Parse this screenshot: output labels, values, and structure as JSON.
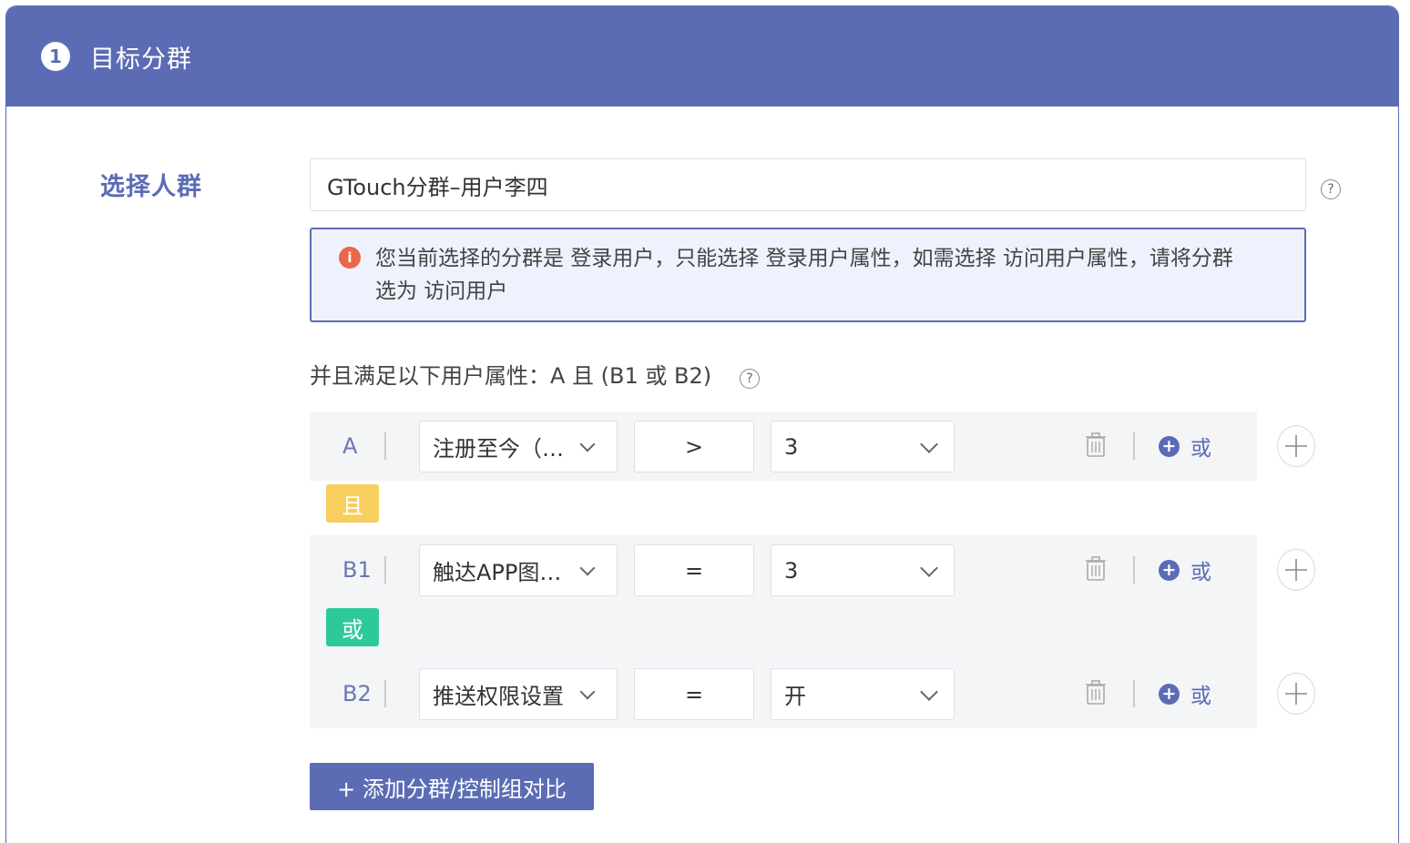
{
  "section": {
    "step_number": "1",
    "title": "目标分群"
  },
  "audience": {
    "label": "选择人群",
    "value": "GTouch分群–用户李四",
    "help_icon": "?"
  },
  "notice": {
    "icon": "i",
    "text": "您当前选择的分群是 登录用户，只能选择 登录用户属性，如需选择 访问用户属性，请将分群选为 访问用户"
  },
  "conditions": {
    "description": "并且满足以下用户属性：A 且 (B1 或 B2)",
    "help_icon": "?",
    "connector_and": "且",
    "connector_or": "或",
    "rows": [
      {
        "label": "A",
        "attribute": "注册至今（…",
        "operator": ">",
        "value": "3",
        "or_label": "或"
      },
      {
        "label": "B1",
        "attribute": "触达APP图…",
        "operator": "=",
        "value": "3",
        "or_label": "或"
      },
      {
        "label": "B2",
        "attribute": "推送权限设置",
        "operator": "=",
        "value": "开",
        "or_label": "或"
      }
    ]
  },
  "add_group_button": "+ 添加分群/控制组对比",
  "colors": {
    "primary": "#5b6cb5",
    "and_badge": "#f8ce5f",
    "or_badge": "#2ec99a",
    "notice_bg": "#eff2fc",
    "notice_icon": "#e8674a"
  }
}
